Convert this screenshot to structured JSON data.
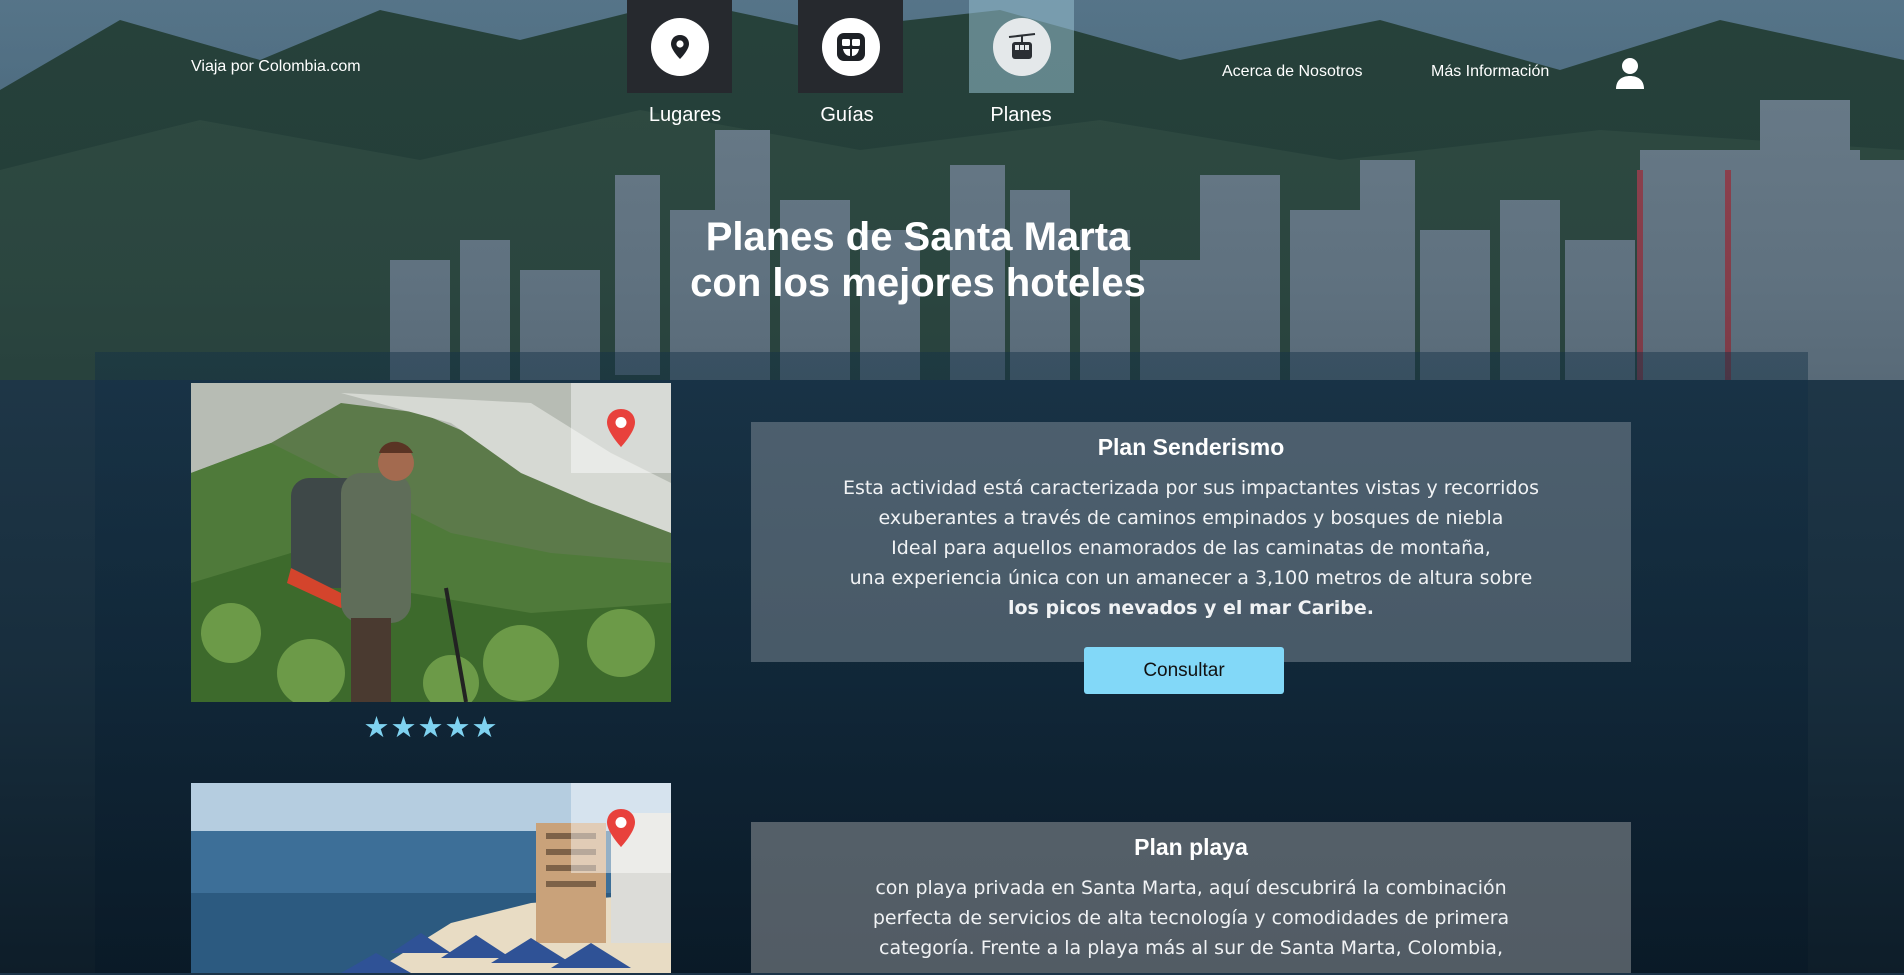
{
  "header": {
    "brand": "Viaja por Colombia.com",
    "tabs": [
      {
        "label": "Lugares",
        "icon": "map-pin-icon",
        "active": false
      },
      {
        "label": "Guías",
        "icon": "guide-book-icon",
        "active": false
      },
      {
        "label": "Planes",
        "icon": "cable-car-icon",
        "active": true
      }
    ],
    "links": [
      "Acerca de Nosotros",
      "Más Información"
    ],
    "user_icon": "user-icon"
  },
  "hero": {
    "title_line1": "Planes de Santa Marta",
    "title_line2": "con los mejores hoteles"
  },
  "plans": [
    {
      "title": "Plan Senderismo",
      "lines": [
        "Esta actividad está caracterizada por sus impactantes vistas y recorridos",
        "exuberantes a través de caminos empinados y bosques de niebla",
        "Ideal para aquellos enamorados de las caminatas de montaña,",
        "una experiencia única con un amanecer a 3,100 metros de altura sobre"
      ],
      "strong_line": "los picos nevados y el mar Caribe.",
      "rating": "★★★★★",
      "rating_value": 5,
      "button": "Consultar"
    },
    {
      "title": "Plan playa",
      "lines": [
        "con playa privada en Santa Marta, aquí descubrirá la combinación",
        "perfecta de servicios de alta tecnología y comodidades de primera",
        "categoría. Frente a la playa más al sur de Santa Marta, Colombia,"
      ]
    }
  ],
  "colors": {
    "accent": "#82d8f8",
    "star": "#7fd2f0",
    "pin": "#e8413c",
    "tab_dark": "#26292e"
  }
}
